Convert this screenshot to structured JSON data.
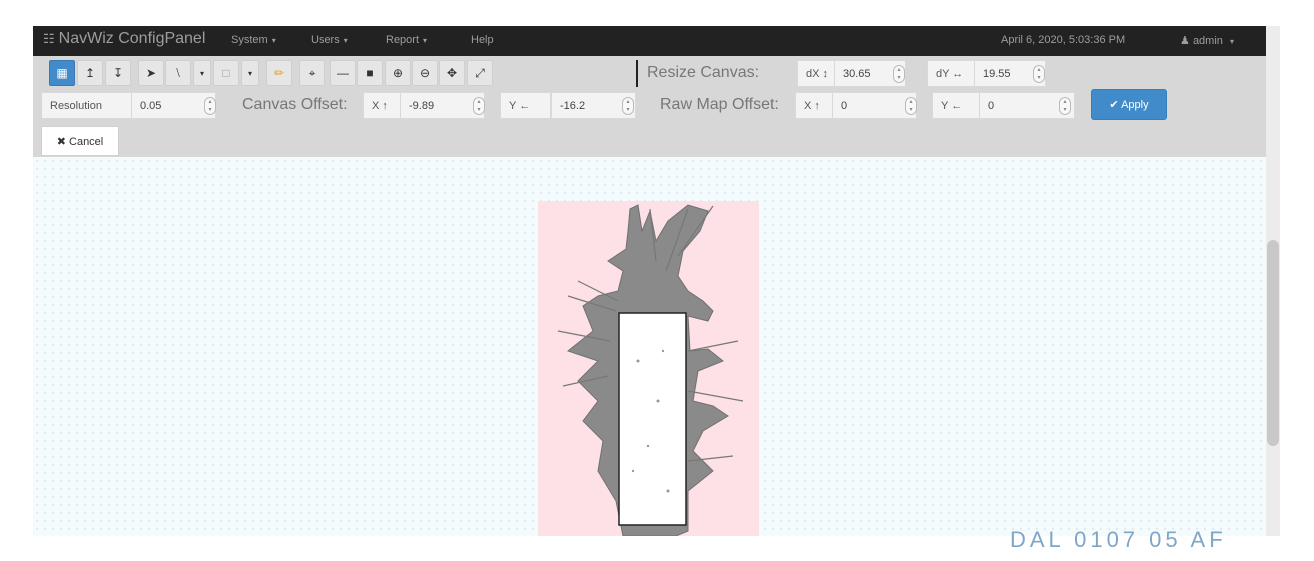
{
  "navbar": {
    "brand": "NavWiz ConfigPanel",
    "menus": [
      {
        "label": "System",
        "caret": "▾"
      },
      {
        "label": "Users",
        "caret": "▾"
      },
      {
        "label": "Report",
        "caret": "▾"
      },
      {
        "label": "Help",
        "caret": ""
      }
    ],
    "datetime": "April 6, 2020, 5:03:36 PM",
    "user": "admin",
    "user_caret": "▾"
  },
  "toolbar": {
    "icons": [
      "save-icon",
      "upload-icon",
      "download-icon",
      "pointer-icon",
      "line-icon",
      "caret-down-icon",
      "rectangle-icon",
      "caret-down-icon",
      "pencil-icon",
      "crop-icon",
      "minus-icon",
      "fill-icon",
      "zoom-in-icon",
      "zoom-out-icon",
      "move-icon",
      "resize-icon"
    ],
    "resize_canvas": {
      "label": "Resize Canvas:",
      "dx_label": "dX ↕",
      "dx_value": "30.65",
      "dy_label": "dY ↔",
      "dy_value": "19.55"
    },
    "resolution": {
      "label": "Resolution",
      "value": "0.05"
    },
    "canvas_offset": {
      "label": "Canvas Offset:",
      "x_label": "X ↑",
      "x_value": "-9.89",
      "y_label": "Y ←",
      "y_value": "-16.2"
    },
    "raw_map_offset": {
      "label": "Raw Map Offset:",
      "x_label": "X ↑",
      "x_value": "0",
      "y_label": "Y ←",
      "y_value": "0"
    },
    "apply_label": "✔ Apply",
    "cancel_label": "✖ Cancel"
  },
  "watermark": "DAL 0107 05 AF",
  "colors": {
    "navbar_bg": "#222222",
    "toolbar_bg": "#d7d7d7",
    "primary": "#428bca",
    "map_bg": "#fde1e7",
    "canvas_bg": "#f3fbfd"
  }
}
